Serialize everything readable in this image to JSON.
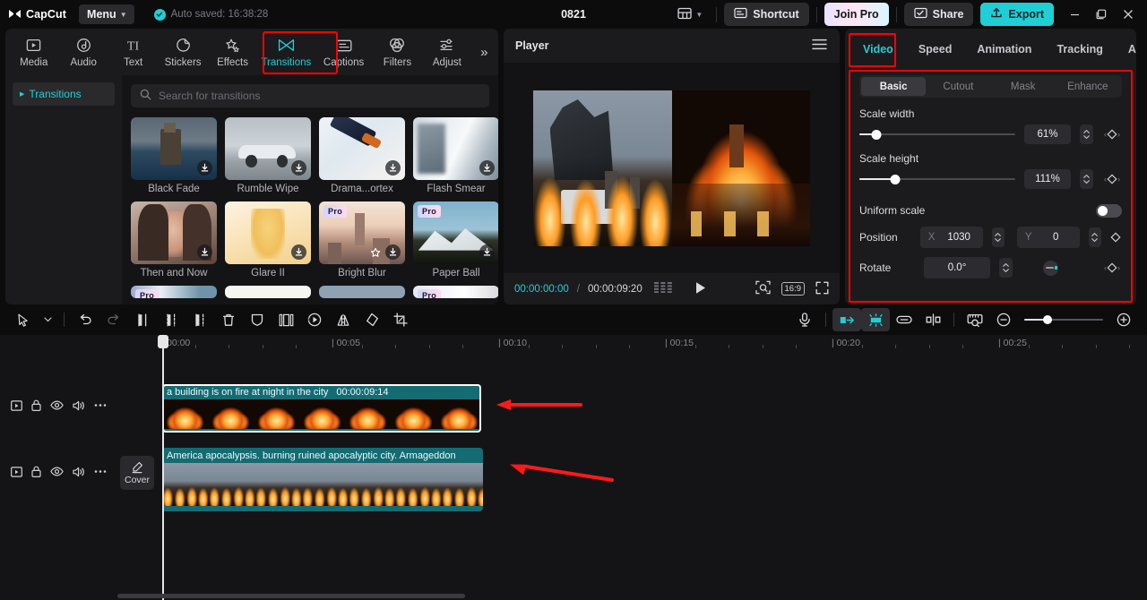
{
  "titlebar": {
    "brand": "CapCut",
    "menu_label": "Menu",
    "autosave_text": "Auto saved: 16:38:28",
    "project_name": "0821",
    "shortcut_label": "Shortcut",
    "join_pro_label": "Join Pro",
    "share_label": "Share",
    "export_label": "Export",
    "accent_color": "#20cfd6",
    "highlight_color": "#ff0000"
  },
  "library": {
    "tabs": [
      {
        "label": "Media",
        "icon": "media-icon",
        "active": false
      },
      {
        "label": "Audio",
        "icon": "audio-icon",
        "active": false
      },
      {
        "label": "Text",
        "icon": "text-icon",
        "active": false
      },
      {
        "label": "Stickers",
        "icon": "stickers-icon",
        "active": false
      },
      {
        "label": "Effects",
        "icon": "effects-icon",
        "active": false
      },
      {
        "label": "Transitions",
        "icon": "transitions-icon",
        "active": true
      },
      {
        "label": "Captions",
        "icon": "captions-icon",
        "active": false
      },
      {
        "label": "Filters",
        "icon": "filters-icon",
        "active": false
      },
      {
        "label": "Adjust",
        "icon": "adjust-icon",
        "active": false
      }
    ],
    "nav_item": "Transitions",
    "search_placeholder": "Search for transitions",
    "search_value": "",
    "items": [
      {
        "name": "Black Fade",
        "pro": false,
        "fav": false
      },
      {
        "name": "Rumble Wipe",
        "pro": false,
        "fav": false
      },
      {
        "name": "Drama...ortex",
        "pro": false,
        "fav": false
      },
      {
        "name": "Flash Smear",
        "pro": false,
        "fav": false
      },
      {
        "name": "Then and Now",
        "pro": false,
        "fav": false
      },
      {
        "name": "Glare II",
        "pro": false,
        "fav": false
      },
      {
        "name": "Bright Blur",
        "pro": true,
        "fav": true
      },
      {
        "name": "Paper Ball",
        "pro": true,
        "fav": false
      }
    ],
    "pro_badge": "Pro"
  },
  "player": {
    "title": "Player",
    "current_time": "00:00:00:00",
    "separator": "/",
    "total_time": "00:00:09:20",
    "aspect_ratio": "16:9"
  },
  "properties": {
    "tabs": [
      {
        "label": "Video",
        "active": true
      },
      {
        "label": "Speed",
        "active": false
      },
      {
        "label": "Animation",
        "active": false
      },
      {
        "label": "Tracking",
        "active": false
      },
      {
        "label": "Adjust",
        "active": false
      }
    ],
    "segments": [
      {
        "label": "Basic",
        "active": true
      },
      {
        "label": "Cutout",
        "active": false
      },
      {
        "label": "Mask",
        "active": false
      },
      {
        "label": "Enhance",
        "active": false
      }
    ],
    "scale_width": {
      "label": "Scale width",
      "value": "61%",
      "percent": 11
    },
    "scale_height": {
      "label": "Scale height",
      "value": "111%",
      "percent": 22
    },
    "uniform_scale": {
      "label": "Uniform scale",
      "on": false
    },
    "position": {
      "label": "Position",
      "x_axis": "X",
      "x_value": "1030",
      "y_axis": "Y",
      "y_value": "0"
    },
    "rotate": {
      "label": "Rotate",
      "value": "0.0°"
    }
  },
  "timeline": {
    "toolbar_icons": [
      "select-tool-icon",
      "dropdown-caret-icon",
      "undo-icon",
      "redo-icon",
      "split-icon",
      "trim-left-icon",
      "trim-right-icon",
      "delete-icon",
      "freeze-icon",
      "split-screen-icon",
      "speed-icon",
      "mirror-icon",
      "rotate-icon",
      "crop-icon"
    ],
    "right_icons": [
      "voiceover-icon",
      "adsorption-icon",
      "auto-snap-icon",
      "link-icon",
      "split-view-icon",
      "preview-icon",
      "zoom-out-icon",
      "zoom-in-icon"
    ],
    "zoom_percent": 30,
    "ruler_labels": [
      "00:00",
      "00:05",
      "00:10",
      "00:15",
      "00:20",
      "00:25"
    ],
    "playhead_time": "00:00",
    "track_head_icons": [
      "track-type-icon",
      "lock-icon",
      "eye-icon",
      "volume-icon",
      "more-icon"
    ],
    "cover_label": "Cover",
    "clips": [
      {
        "title": "a building is on fire at night in the city",
        "duration": "00:00:09:14",
        "selected": true,
        "kind": "flame"
      },
      {
        "title": "America apocalypsis. burning ruined apocalyptic city. Armageddon",
        "duration": "",
        "selected": false,
        "kind": "apoc"
      }
    ]
  }
}
